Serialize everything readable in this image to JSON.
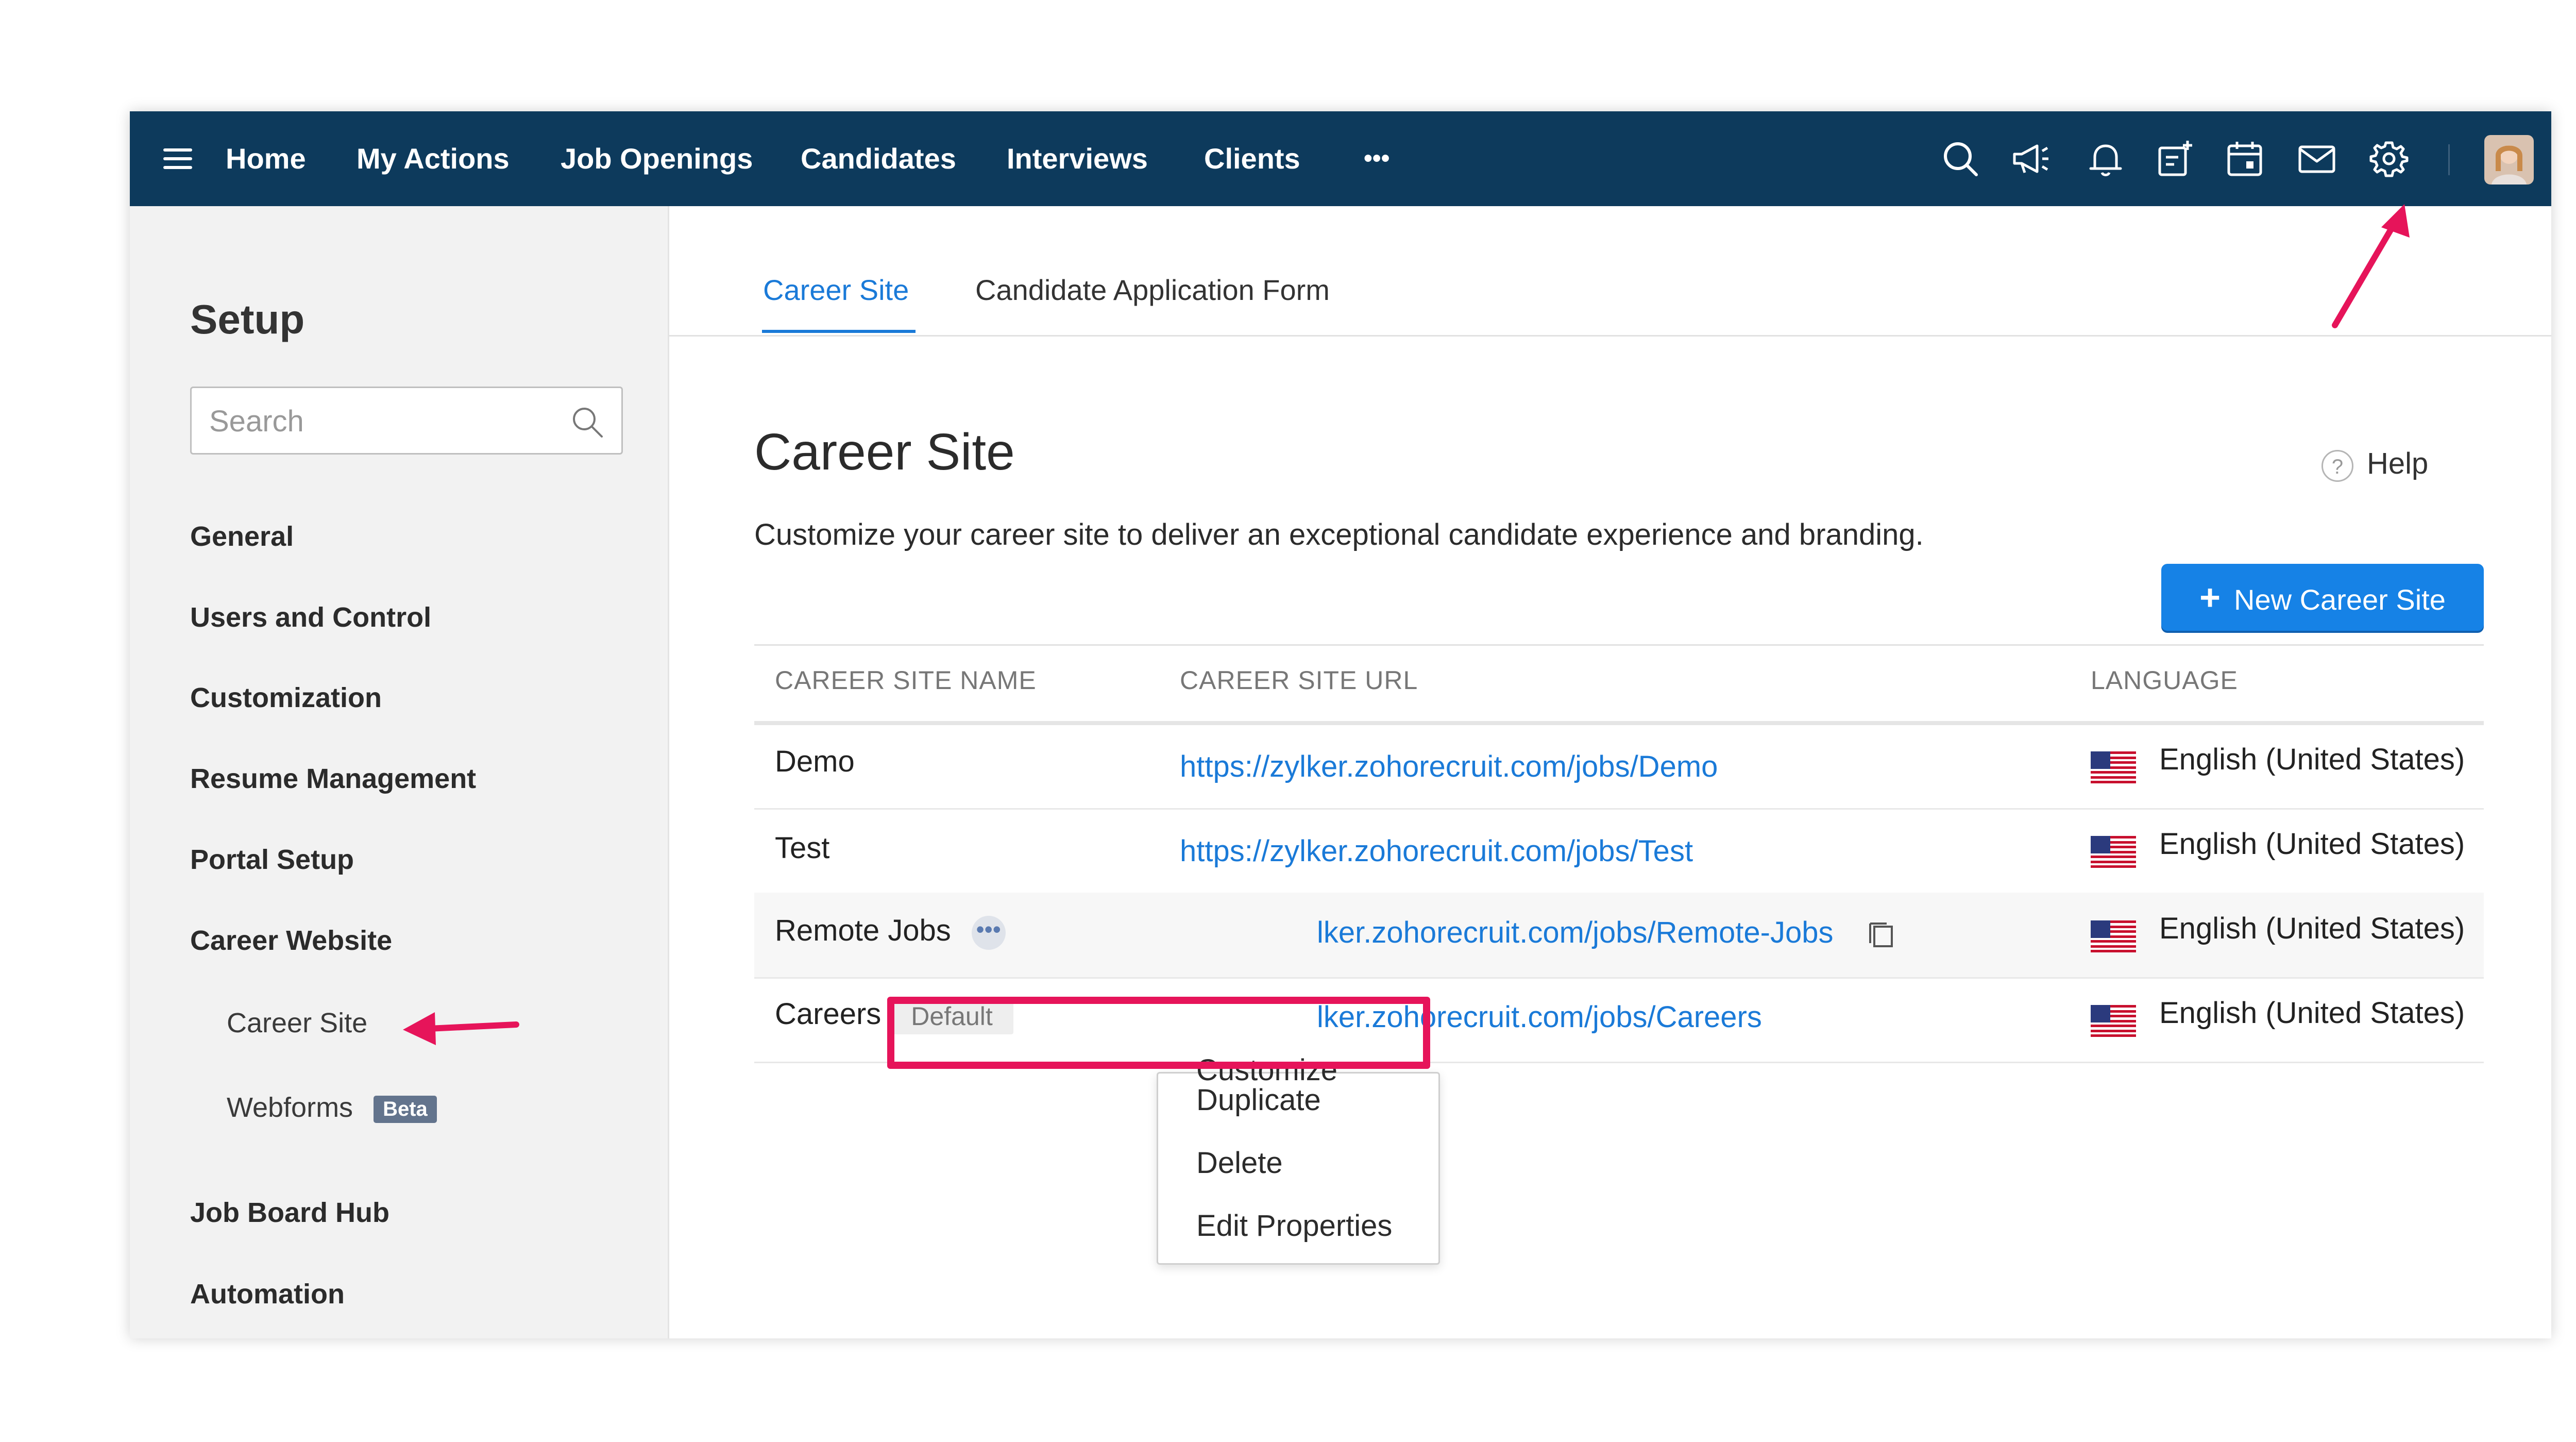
{
  "nav": {
    "menu_icon": "hamburger-icon",
    "items": [
      "Home",
      "My Actions",
      "Job Openings",
      "Candidates",
      "Interviews",
      "Clients"
    ],
    "more": "•••",
    "icons": [
      "search-icon",
      "megaphone-icon",
      "bell-icon",
      "add-task-icon",
      "calendar-icon",
      "mail-icon",
      "gear-icon"
    ]
  },
  "sidebar": {
    "title": "Setup",
    "search_placeholder": "Search",
    "items": [
      "General",
      "Users and Control",
      "Customization",
      "Resume Management",
      "Portal Setup",
      "Career Website"
    ],
    "sub_items": [
      "Career Site",
      "Webforms"
    ],
    "beta_label": "Beta",
    "items_after": [
      "Job Board Hub",
      "Automation"
    ]
  },
  "tabs": [
    "Career Site",
    "Candidate Application Form"
  ],
  "page": {
    "title": "Career Site",
    "help": "Help",
    "subtitle": "Customize your career site to deliver an exceptional candidate experience and branding.",
    "new_button": "New Career Site"
  },
  "table": {
    "headers": [
      "CAREER SITE NAME",
      "CAREER SITE URL",
      "LANGUAGE"
    ],
    "rows": [
      {
        "name": "Demo",
        "url": "https://zylker.zohorecruit.com/jobs/Demo",
        "language": "English (United States)"
      },
      {
        "name": "Test",
        "url": "https://zylker.zohorecruit.com/jobs/Test",
        "language": "English (United States)"
      },
      {
        "name": "Remote Jobs",
        "url": "lker.zohorecruit.com/jobs/Remote-Jobs",
        "language": "English (United States)"
      },
      {
        "name": "Careers",
        "badge": "Default",
        "url": "lker.zohorecruit.com/jobs/Careers",
        "language": "English (United States)"
      }
    ]
  },
  "dropdown": {
    "items": [
      "Customize",
      "Duplicate",
      "Delete",
      "Edit Properties"
    ]
  },
  "colors": {
    "nav_bg": "#0d3a5c",
    "accent": "#1a7ad8",
    "highlight": "#e6145a"
  }
}
